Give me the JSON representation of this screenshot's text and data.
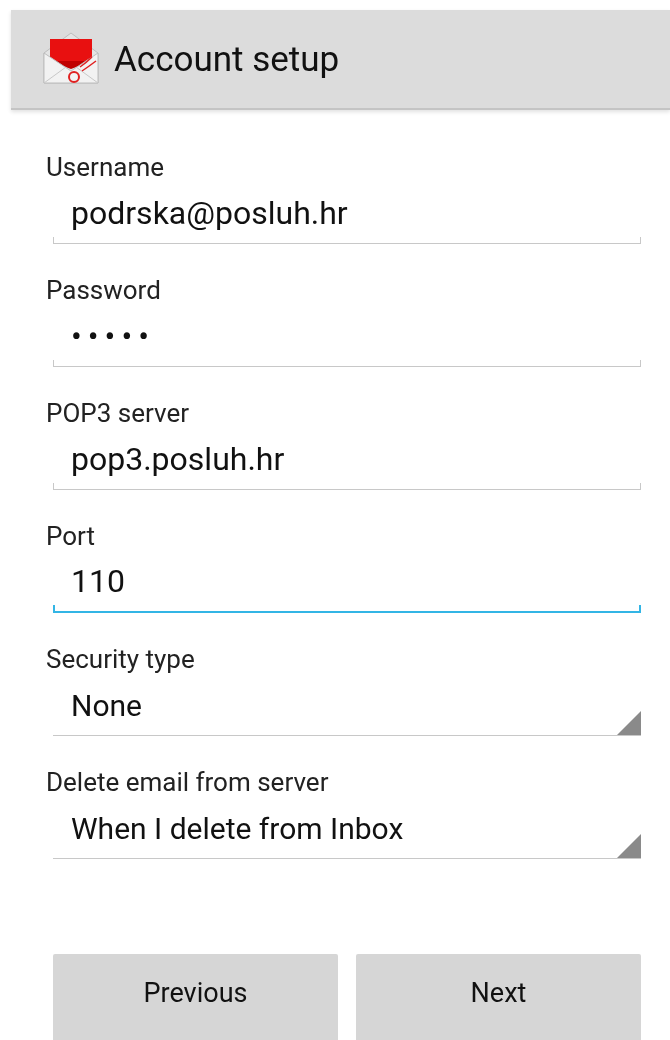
{
  "action_bar": {
    "title": "Account setup"
  },
  "fields": [
    {
      "label": "Username",
      "kind": "text",
      "value": "podrska@posluh.hr",
      "focused": false
    },
    {
      "label": "Password",
      "kind": "password",
      "value": "•••••",
      "focused": false
    },
    {
      "label": "POP3 server",
      "kind": "text",
      "value": "pop3.posluh.hr",
      "focused": false
    },
    {
      "label": "Port",
      "kind": "text",
      "value": "110",
      "focused": true
    },
    {
      "label": "Security type",
      "kind": "spinner",
      "value": "None",
      "focused": false
    },
    {
      "label": "Delete email from server",
      "kind": "spinner",
      "value": "When I delete from Inbox",
      "focused": false
    }
  ],
  "buttons": [
    "Previous",
    "Next"
  ]
}
